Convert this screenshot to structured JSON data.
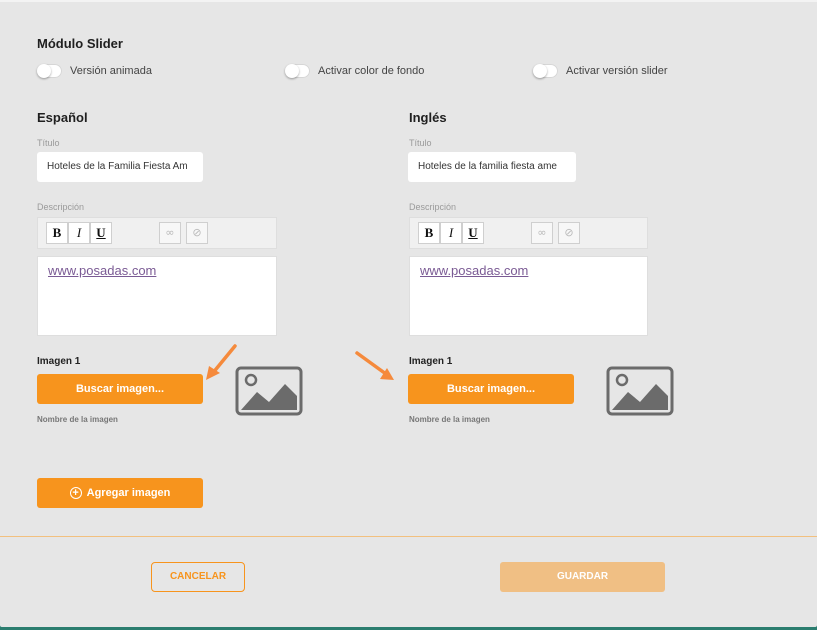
{
  "module": {
    "title": "Módulo Slider",
    "toggles": [
      {
        "label": "Versión animada",
        "on": false
      },
      {
        "label": "Activar color de fondo",
        "on": false
      },
      {
        "label": "Activar versión slider",
        "on": false
      }
    ]
  },
  "columns": [
    {
      "heading": "Español",
      "title_label": "Título",
      "title_value": "Hoteles de la Familia Fiesta Am",
      "description_label": "Descripción",
      "description_link": "www.posadas.com",
      "image_label": "Imagen 1",
      "search_button": "Buscar imagen...",
      "image_name_label": "Nombre de la imagen"
    },
    {
      "heading": "Inglés",
      "title_label": "Título",
      "title_value": "Hoteles de la familia fiesta ame",
      "description_label": "Descripción",
      "description_link": "www.posadas.com",
      "image_label": "Imagen 1",
      "search_button": "Buscar imagen...",
      "image_name_label": "Nombre de la imagen"
    }
  ],
  "toolbar": {
    "bold": "B",
    "italic": "I",
    "underline": "U",
    "link_icon": "link-icon",
    "unlink_icon": "unlink-icon"
  },
  "add_image_button": "Agregar imagen",
  "footer": {
    "cancel": "CANCELAR",
    "save": "GUARDAR"
  },
  "colors": {
    "accent": "#f7941d",
    "accent_disabled": "#f0bf84",
    "background": "#e6e6e6",
    "annotation_arrow": "#f58a3c"
  }
}
